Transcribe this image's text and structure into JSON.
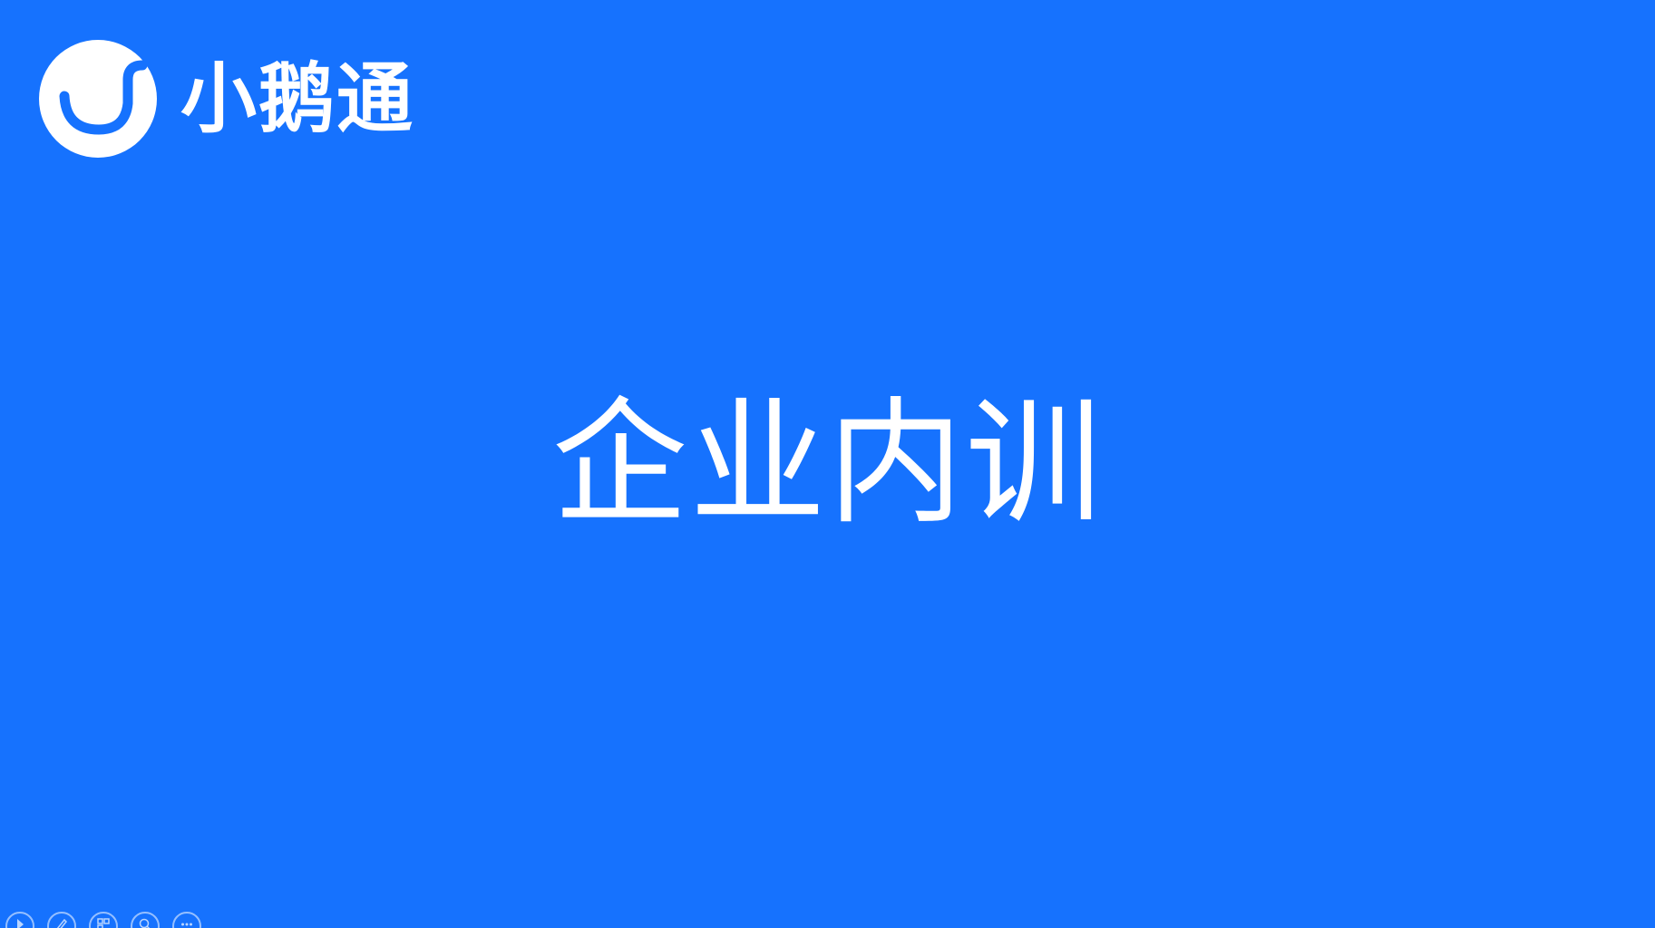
{
  "brand": {
    "name": "小鹅通",
    "logo_icon": "duck-logo-icon",
    "color": "#1672fe"
  },
  "slide": {
    "title": "企业内训",
    "background": "#1672fe",
    "text_color": "#ffffff"
  },
  "presenter_controls": [
    {
      "icon": "play-icon"
    },
    {
      "icon": "pen-icon"
    },
    {
      "icon": "slides-icon"
    },
    {
      "icon": "zoom-icon"
    },
    {
      "icon": "more-icon"
    }
  ]
}
